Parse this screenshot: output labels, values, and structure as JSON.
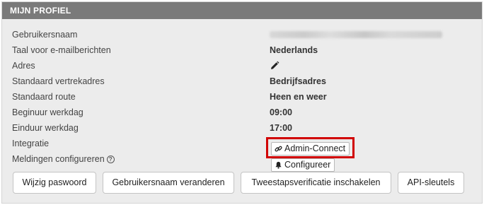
{
  "profile": {
    "header": "MIJN PROFIEL",
    "rows": [
      {
        "label": "Gebruikersnaam",
        "value": ""
      },
      {
        "label": "Taal voor e-mailberichten",
        "value": "Nederlands"
      },
      {
        "label": "Adres",
        "value": ""
      },
      {
        "label": "Standaard vertrekadres",
        "value": "Bedrijfsadres"
      },
      {
        "label": "Standaard route",
        "value": "Heen en weer"
      },
      {
        "label": "Beginuur werkdag",
        "value": "09:00"
      },
      {
        "label": "Einduur werkdag",
        "value": "17:00"
      },
      {
        "label": "Integratie",
        "value": ""
      },
      {
        "label": "Meldingen configureren",
        "value": ""
      }
    ],
    "info_icon_glyph": "?",
    "integration_button": "Admin-Connect",
    "notifications_button": "Configureer",
    "actions": [
      {
        "label": "Wijzig paswoord"
      },
      {
        "label": "Gebruikersnaam veranderen"
      },
      {
        "label": "Tweestapsverificatie inschakelen"
      },
      {
        "label": "API-sleutels"
      }
    ]
  },
  "icons": {
    "edit": "pencil-icon",
    "link": "link-icon",
    "bell": "bell-icon",
    "info": "info-icon"
  },
  "colors": {
    "header_bg": "#7a7a7a",
    "panel_bg": "#ececec",
    "highlight": "#d10000"
  }
}
